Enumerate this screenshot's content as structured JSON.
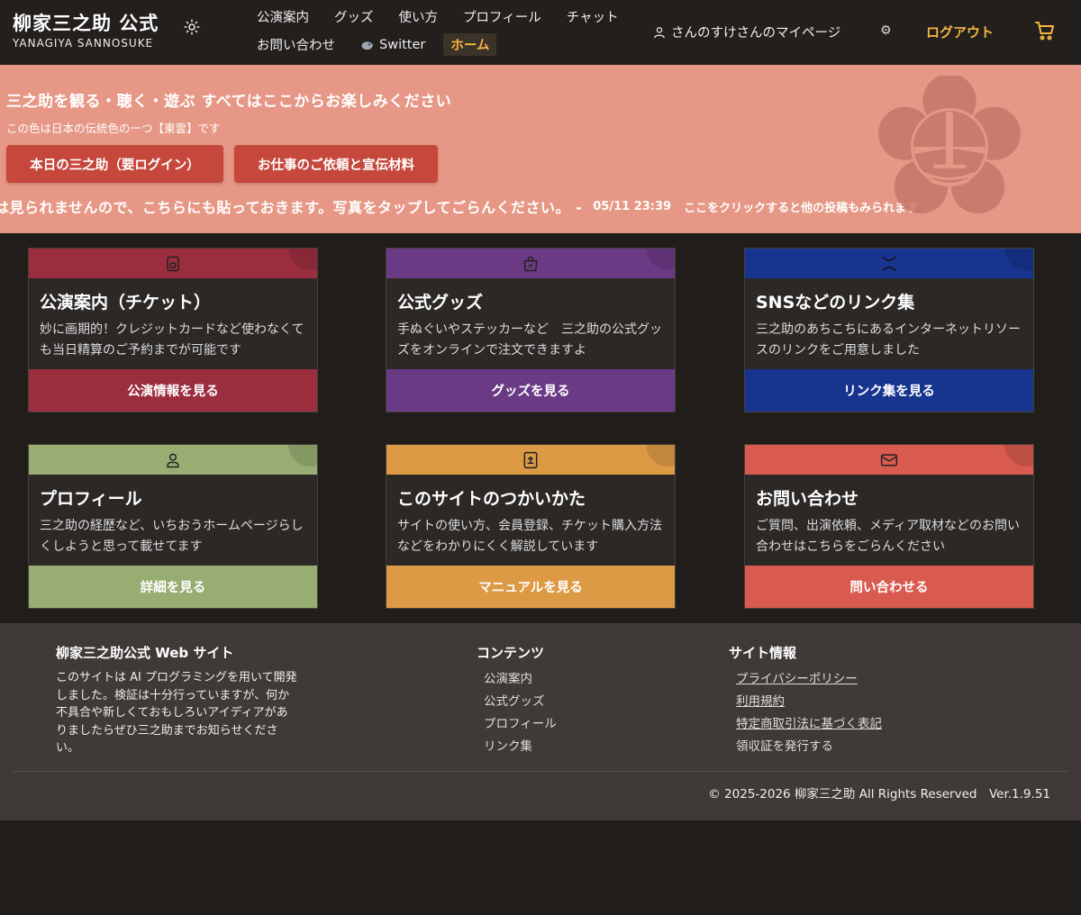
{
  "colors": {
    "accent": "#f5b642",
    "hero_bg": "#e69785",
    "hero_button": "#c6483c",
    "card_ticket": "#9b2e3e",
    "card_goods": "#6b3a85",
    "card_links": "#17348e",
    "card_profile": "#97ad72",
    "card_manual": "#dc9a45",
    "card_contact": "#d95b4f"
  },
  "header": {
    "brand_title": "柳家三之助 公式",
    "brand_sub": "YANAGIYA SANNOSUKE",
    "theme_icon": "sun-icon",
    "nav": {
      "row1": [
        "公演案内",
        "グッズ",
        "使い方",
        "プロフィール",
        "チャット"
      ],
      "contact": "お問い合わせ",
      "switter": "Switter",
      "home": "ホーム"
    },
    "mypage": "さんのすけさんのマイページ",
    "settings_glyph": "⚙",
    "logout": "ログアウト",
    "cart_icon": "cart-icon"
  },
  "hero": {
    "title": "三之助を観る・聴く・遊ぶ すべてはここからお楽しみください",
    "subtitle": "この色は日本の伝統色の一つ【東雲】です",
    "button_today": "本日の三之助（要ログイン）",
    "button_work": "お仕事のご依頼と宣伝材料",
    "ticker_text": "は見られませんので、こちらにも貼っておきます。写真をタップしてごらんください。 -",
    "ticker_time": "05/11 23:39",
    "ticker_link": "ここをクリックすると他の投稿もみられます"
  },
  "cards": [
    {
      "title": "公演案内（チケット）",
      "desc": "妙に画期的！クレジットカードなど使わなくても当日精算のご予約までが可能です",
      "button": "公演情報を見る",
      "icon": "ticket-icon"
    },
    {
      "title": "公式グッズ",
      "desc": "手ぬぐいやステッカーなど　三之助の公式グッズをオンラインで注文できますよ",
      "button": "グッズを見る",
      "icon": "shopping-bag-icon"
    },
    {
      "title": "SNSなどのリンク集",
      "desc": "三之助のあちこちにあるインターネットリソースのリンクをご用意しました",
      "button": "リンク集を見る",
      "icon": "x-logo-icon"
    },
    {
      "title": "プロフィール",
      "desc": "三之助の経歴など、いちおうホームページらしくしようと思って載せてます",
      "button": "詳細を見る",
      "icon": "person-icon"
    },
    {
      "title": "このサイトのつかいかた",
      "desc": "サイトの使い方、会員登録、チケット購入方法などをわかりにくく解説しています",
      "button": "マニュアルを見る",
      "icon": "book-upload-icon"
    },
    {
      "title": "お問い合わせ",
      "desc": "ご質問、出演依頼、メディア取材などのお問い合わせはこちらをごらんください",
      "button": "問い合わせる",
      "icon": "mail-icon"
    }
  ],
  "footer": {
    "about_title": "柳家三之助公式 Web サイト",
    "about_text": "このサイトは AI プログラミングを用いて開発しました。検証は十分行っていますが、何か不具合や新しくておもしろいアイディアがありましたらぜひ三之助までお知らせください。",
    "contents_title": "コンテンツ",
    "contents": [
      "公演案内",
      "公式グッズ",
      "プロフィール",
      "リンク集"
    ],
    "info_title": "サイト情報",
    "info": [
      "プライバシーポリシー",
      "利用規約",
      "特定商取引法に基づく表記",
      "領収証を発行する"
    ],
    "copyright": "© 2025-2026 柳家三之助 All Rights Reserved　Ver.1.9.51"
  }
}
